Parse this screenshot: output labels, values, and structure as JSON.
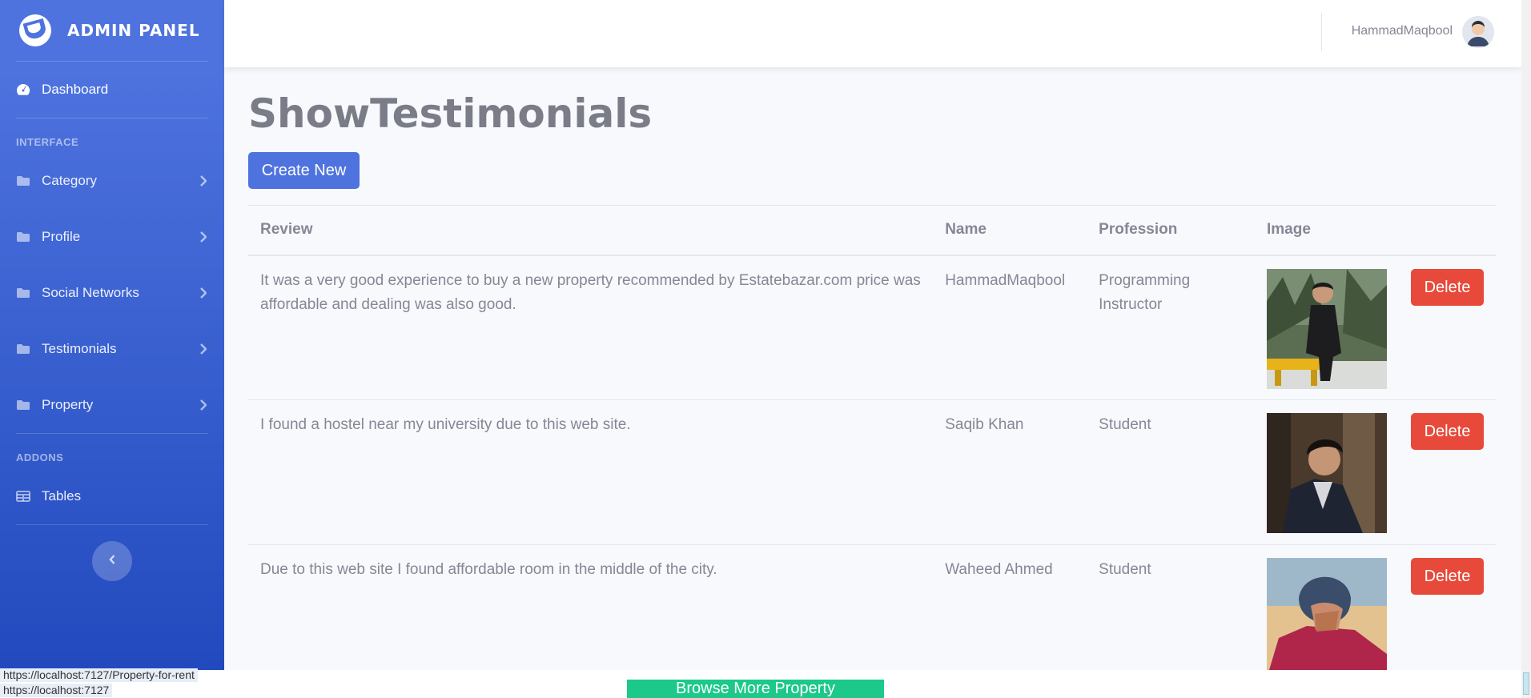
{
  "sidebar": {
    "brand": "ADMIN PANEL",
    "dashboard": "Dashboard",
    "interface_heading": "INTERFACE",
    "items": [
      {
        "label": "Category"
      },
      {
        "label": "Profile"
      },
      {
        "label": "Social Networks"
      },
      {
        "label": "Testimonials"
      },
      {
        "label": "Property"
      }
    ],
    "addons_heading": "ADDONS",
    "tables": "Tables"
  },
  "topbar": {
    "user_name": "HammadMaqbool"
  },
  "main": {
    "title": "ShowTestimonials",
    "create_label": "Create New",
    "columns": [
      "Review",
      "Name",
      "Profession",
      "Image"
    ],
    "rows": [
      {
        "review": "It was a very good experience to buy a new property recommended by Estatebazar.com price was affordable and dealing was also good.",
        "name": "HammadMaqbool",
        "profession": "Programming Instructor",
        "delete": "Delete"
      },
      {
        "review": "I found a hostel near my university due to this web site.",
        "name": "Saqib Khan",
        "profession": "Student",
        "delete": "Delete"
      },
      {
        "review": "Due to this web site I found affordable room in the middle of the city.",
        "name": "Waheed Ahmed",
        "profession": "Student",
        "delete": "Delete"
      }
    ]
  },
  "overlay": {
    "browse_label": "Browse More Property",
    "status_url_1": "https://localhost:7127/Property-for-rent",
    "status_url_2": "https://localhost:7127"
  },
  "colors": {
    "primary": "#4e73df",
    "danger": "#e74a3b",
    "success": "#1cc88a"
  }
}
